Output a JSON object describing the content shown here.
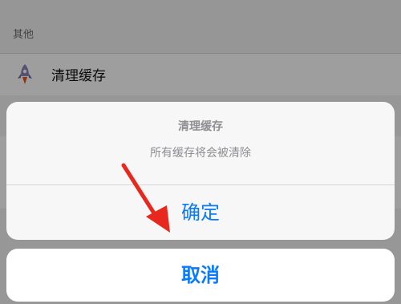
{
  "background": {
    "section_header": "其他",
    "row_label": "清理缓存"
  },
  "action_sheet": {
    "title": "清理缓存",
    "message": "所有缓存将会被清除",
    "confirm_label": "确定",
    "cancel_label": "取消"
  },
  "colors": {
    "accent": "#0a7aff",
    "annotation_arrow": "#e8281e"
  },
  "icons": {
    "row_icon": "rocket-icon",
    "annotation": "red-arrow-icon"
  }
}
